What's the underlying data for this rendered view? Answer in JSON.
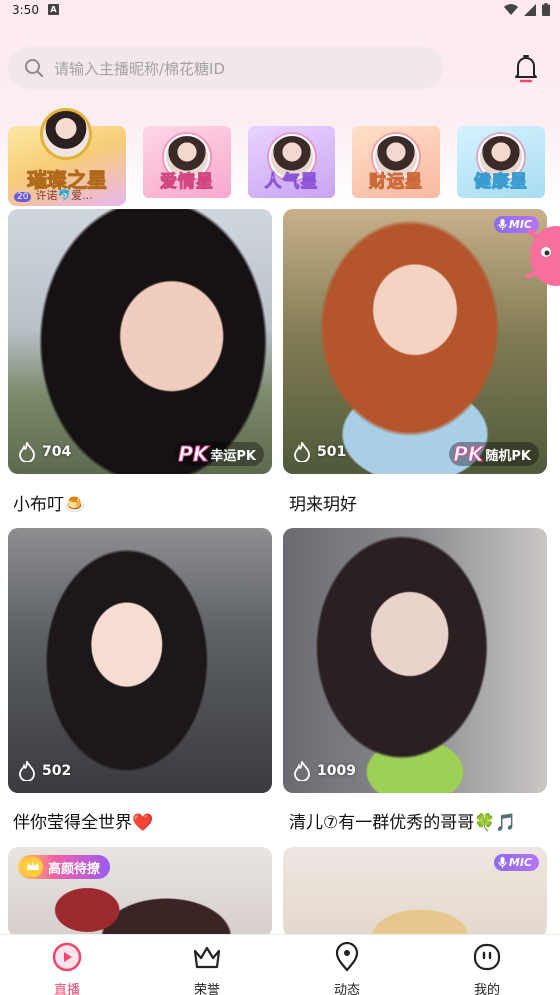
{
  "status_bar": {
    "time": "3:50",
    "notification_badge": "A"
  },
  "search": {
    "placeholder": "请输入主播昵称/棉花糖ID"
  },
  "stars": {
    "featured": {
      "label": "璀璨之星",
      "level": "20",
      "subtitle": "许诺🐬爱..."
    },
    "items": [
      {
        "label": "爱情星"
      },
      {
        "label": "人气星"
      },
      {
        "label": "财运星"
      },
      {
        "label": "健康星"
      }
    ]
  },
  "feed": [
    {
      "name": "小布叮🍮",
      "hot": "704",
      "pk_label": "幸运PK",
      "mic": "",
      "tag": ""
    },
    {
      "name": "玥来玥好",
      "hot": "501",
      "pk_label": "随机PK",
      "mic": "MIC",
      "tag": ""
    },
    {
      "name": "伴你莹得全世界❤️",
      "hot": "502",
      "pk_label": "",
      "mic": "",
      "tag": ""
    },
    {
      "name": "清儿⑦有一群优秀的哥哥🍀🎵",
      "hot": "1009",
      "pk_label": "",
      "mic": "",
      "tag": ""
    },
    {
      "name": "",
      "hot": "",
      "pk_label": "",
      "mic": "",
      "tag": "高颜待撩"
    },
    {
      "name": "",
      "hot": "",
      "pk_label": "",
      "mic": "MIC",
      "tag": ""
    }
  ],
  "pk_mark": "PK",
  "tabs": [
    {
      "label": "直播",
      "icon": "live-icon",
      "active": true
    },
    {
      "label": "荣誉",
      "icon": "crown-icon",
      "active": false
    },
    {
      "label": "动态",
      "icon": "location-pin-icon",
      "active": false
    },
    {
      "label": "我的",
      "icon": "profile-face-icon",
      "active": false
    }
  ],
  "colors": {
    "accent": "#f0476f",
    "mic_badge": "#8a6cf0"
  }
}
